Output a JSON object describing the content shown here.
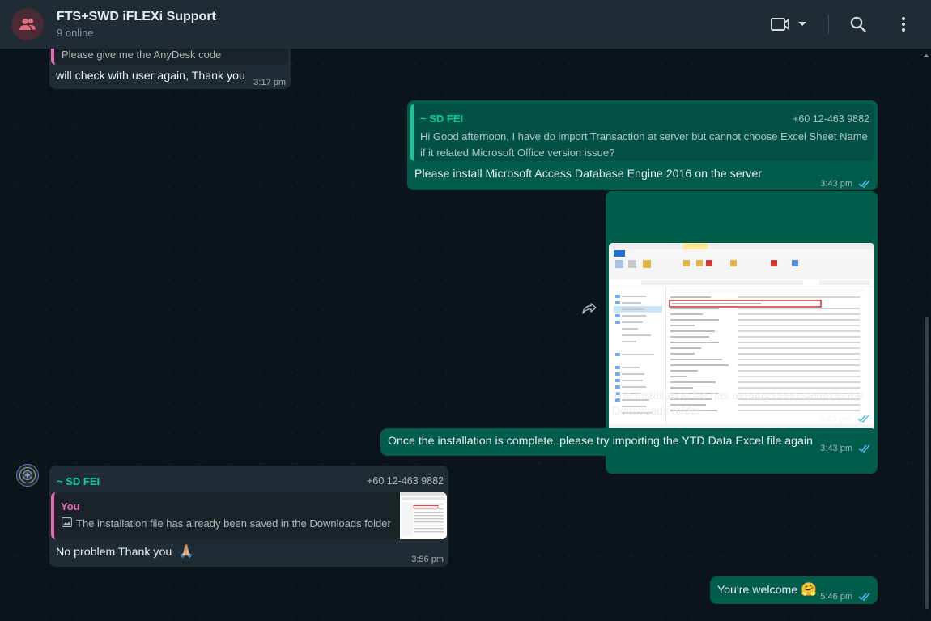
{
  "header": {
    "title": "FTS+SWD iFLEXi Support",
    "status": "9 online",
    "icons": [
      "group-avatar-icon",
      "video-call-icon",
      "dropdown-icon",
      "search-icon",
      "menu-icon"
    ]
  },
  "messages": {
    "m1": {
      "quote_text": "Please give me the AnyDesk code",
      "text": "will check with user again, Thank you",
      "time": "3:17 pm"
    },
    "m2": {
      "quote_name": "~ SD FEI",
      "quote_phone": "+60 12-463 9882",
      "quote_text_line1": "Hi Good afternoon, I have do import Transaction at server but cannot choose Excel Sheet Name",
      "quote_text_line2": "if it related Microsoft Office version issue?",
      "text": "Please install Microsoft Access Database Engine 2016 on the server",
      "time": "3:43 pm"
    },
    "m3": {
      "caption_line1": "The installation file has already been saved in the",
      "caption_line2": "Downloads folder",
      "time": "3:43 pm"
    },
    "m4": {
      "text": "Once the installation is complete, please try importing the YTD Data Excel file again",
      "time": "3:43 pm"
    },
    "m5": {
      "sender": "~ SD FEI",
      "phone": "+60 12-463 9882",
      "quote_name": "You",
      "quote_text": "The installation file has already been saved in the Downloads folder",
      "text": "No problem Thank you",
      "emoji": "🙏🏼",
      "time": "3:56 pm"
    },
    "m6": {
      "text": "You're welcome",
      "emoji": "🤗",
      "time": "5:46 pm"
    }
  },
  "colors": {
    "header": "#202c33",
    "incoming": "#202c33",
    "outgoing": "#005c4b",
    "accent": "#06cf9c",
    "tick_read": "#53bdeb"
  }
}
